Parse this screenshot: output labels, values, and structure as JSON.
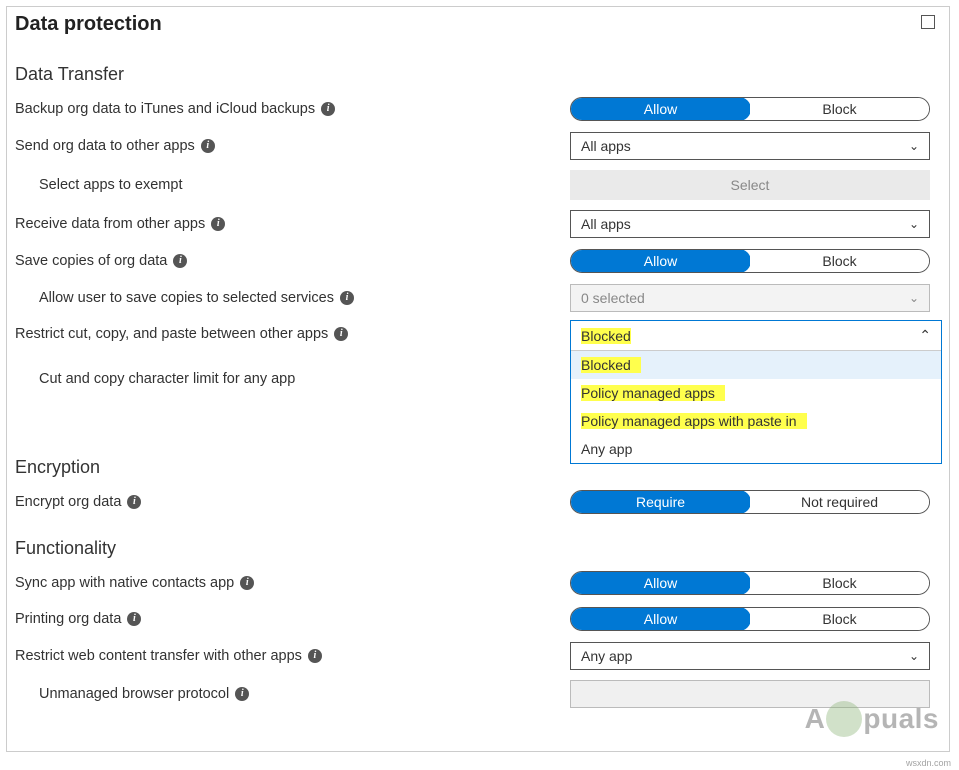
{
  "panel": {
    "title": "Data protection"
  },
  "sections": {
    "data_transfer": {
      "title": "Data Transfer",
      "backup_label": "Backup org data to iTunes and iCloud backups",
      "backup_allow": "Allow",
      "backup_block": "Block",
      "send_label": "Send org data to other apps",
      "send_value": "All apps",
      "exempt_label": "Select apps to exempt",
      "exempt_btn": "Select",
      "receive_label": "Receive data from other apps",
      "receive_value": "All apps",
      "save_label": "Save copies of org data",
      "save_allow": "Allow",
      "save_block": "Block",
      "allow_save_label": "Allow user to save copies to selected services",
      "allow_save_value": "0 selected",
      "restrict_label": "Restrict cut, copy, and paste between other apps",
      "restrict_selected": "Blocked",
      "restrict_options": [
        "Blocked",
        "Policy managed apps",
        "Policy managed apps with paste in",
        "Any app"
      ],
      "charlimit_label": "Cut and copy character limit for any app"
    },
    "encryption": {
      "title": "Encryption",
      "encrypt_label": "Encrypt org data",
      "encrypt_require": "Require",
      "encrypt_notreq": "Not required"
    },
    "functionality": {
      "title": "Functionality",
      "sync_label": "Sync app with native contacts app",
      "sync_allow": "Allow",
      "sync_block": "Block",
      "print_label": "Printing org data",
      "print_allow": "Allow",
      "print_block": "Block",
      "webrestrict_label": "Restrict web content transfer with other apps",
      "webrestrict_value": "Any app",
      "unmanaged_label": "Unmanaged browser protocol"
    }
  },
  "watermark": {
    "left": "A",
    "right": "puals"
  },
  "tiny_url": "wsxdn.com"
}
